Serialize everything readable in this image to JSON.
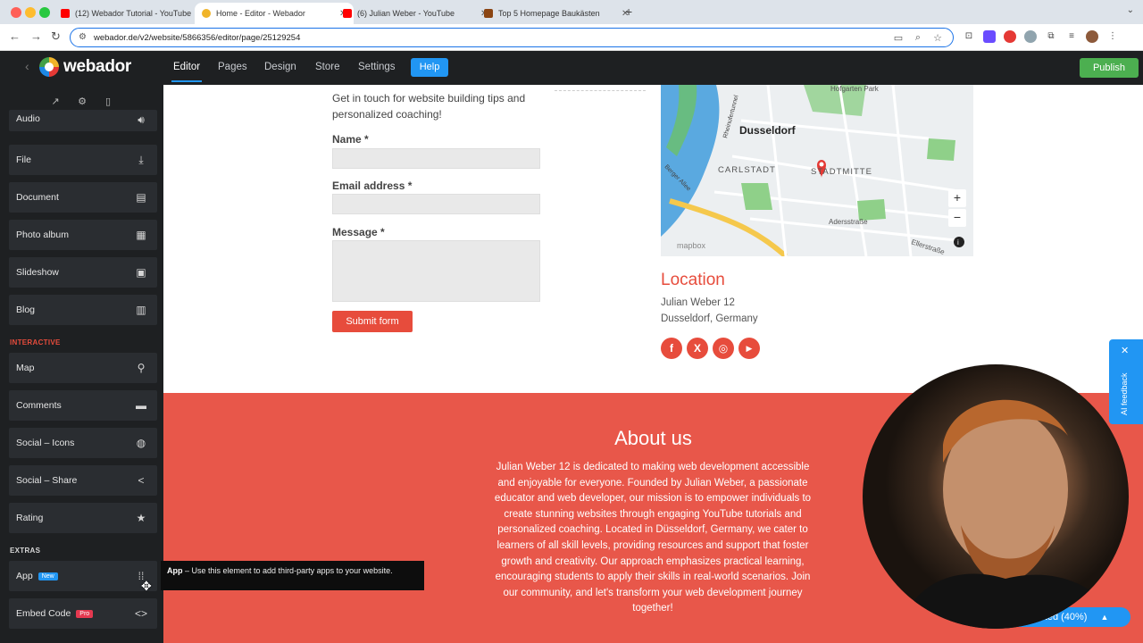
{
  "browser": {
    "tabs": [
      {
        "label": "(12) Webador Tutorial - YouTube",
        "favicon_color": "#ff0000"
      },
      {
        "label": "Home - Editor - Webador",
        "favicon_color": "#f0b429"
      },
      {
        "label": "(6) Julian Weber - YouTube",
        "favicon_color": "#ff0000"
      },
      {
        "label": "Top 5 Homepage Baukästen",
        "favicon_color": "#8b4513"
      }
    ],
    "url": "webador.de/v2/website/5866356/editor/page/25129254"
  },
  "editor": {
    "logo": "webador",
    "menu": [
      "Editor",
      "Pages",
      "Design",
      "Store",
      "Settings"
    ],
    "help_label": "Help",
    "publish_label": "Publish"
  },
  "sidebar": {
    "items_top": [
      {
        "label": "Audio",
        "icon": "audio-icon"
      },
      {
        "label": "File",
        "icon": "download-icon"
      },
      {
        "label": "Document",
        "icon": "document-icon"
      },
      {
        "label": "Photo album",
        "icon": "grid-icon"
      },
      {
        "label": "Slideshow",
        "icon": "slideshow-icon"
      },
      {
        "label": "Blog",
        "icon": "blog-icon"
      }
    ],
    "section_interactive": "INTERACTIVE",
    "items_interactive": [
      {
        "label": "Map",
        "icon": "map-pin-icon"
      },
      {
        "label": "Comments",
        "icon": "comment-icon"
      },
      {
        "label": "Social – Icons",
        "icon": "globe-icon"
      },
      {
        "label": "Social – Share",
        "icon": "share-icon"
      },
      {
        "label": "Rating",
        "icon": "star-icon"
      }
    ],
    "section_extras": "EXTRAS",
    "items_extras": [
      {
        "label": "App",
        "badge": "New",
        "icon": "apps-icon"
      },
      {
        "label": "Embed Code",
        "badge": "Pro",
        "icon": "code-icon"
      }
    ],
    "colors": {
      "interactive_section": "#e74c3c",
      "new_badge": "#2196f3",
      "pro_badge": "#e53950"
    }
  },
  "tooltip": {
    "title": "App",
    "text": " – Use this element to add third-party apps to your website."
  },
  "form": {
    "intro": "Get in touch for website building tips and personalized coaching!",
    "name_label": "Name *",
    "email_label": "Email address *",
    "message_label": "Message *",
    "submit_label": "Submit form"
  },
  "map": {
    "city": "Dusseldorf",
    "labels": [
      "Hofgarten Park",
      "CARLSTADT",
      "STADTMITTE",
      "Adersstraße",
      "Ellerstraße",
      "Rheinufertunnel",
      "Berger Allee",
      "mapbox"
    ],
    "zoom_in": "+",
    "zoom_out": "−"
  },
  "location": {
    "title": "Location",
    "address1": "Julian Weber 12",
    "address2": "Dusseldorf, Germany",
    "accent": "#e74c3c"
  },
  "about": {
    "title": "About us",
    "text": "Julian Weber 12 is dedicated to making web development accessible and enjoyable for everyone. Founded by Julian Weber, a passionate educator and web developer, our mission is to empower individuals to create stunning websites through engaging YouTube tutorials and personalized coaching. Located in Düsseldorf, Germany, we cater to learners of all skill levels, providing resources and support that foster growth and creativity. Our approach emphasizes practical learning, encouraging students to apply their skills in real-world scenarios. Join our community, and let's transform your web development journey together!",
    "background": "#e8574a"
  },
  "feedback": {
    "label": "AI feedback"
  },
  "get_started": {
    "label": "arted (40%)"
  }
}
